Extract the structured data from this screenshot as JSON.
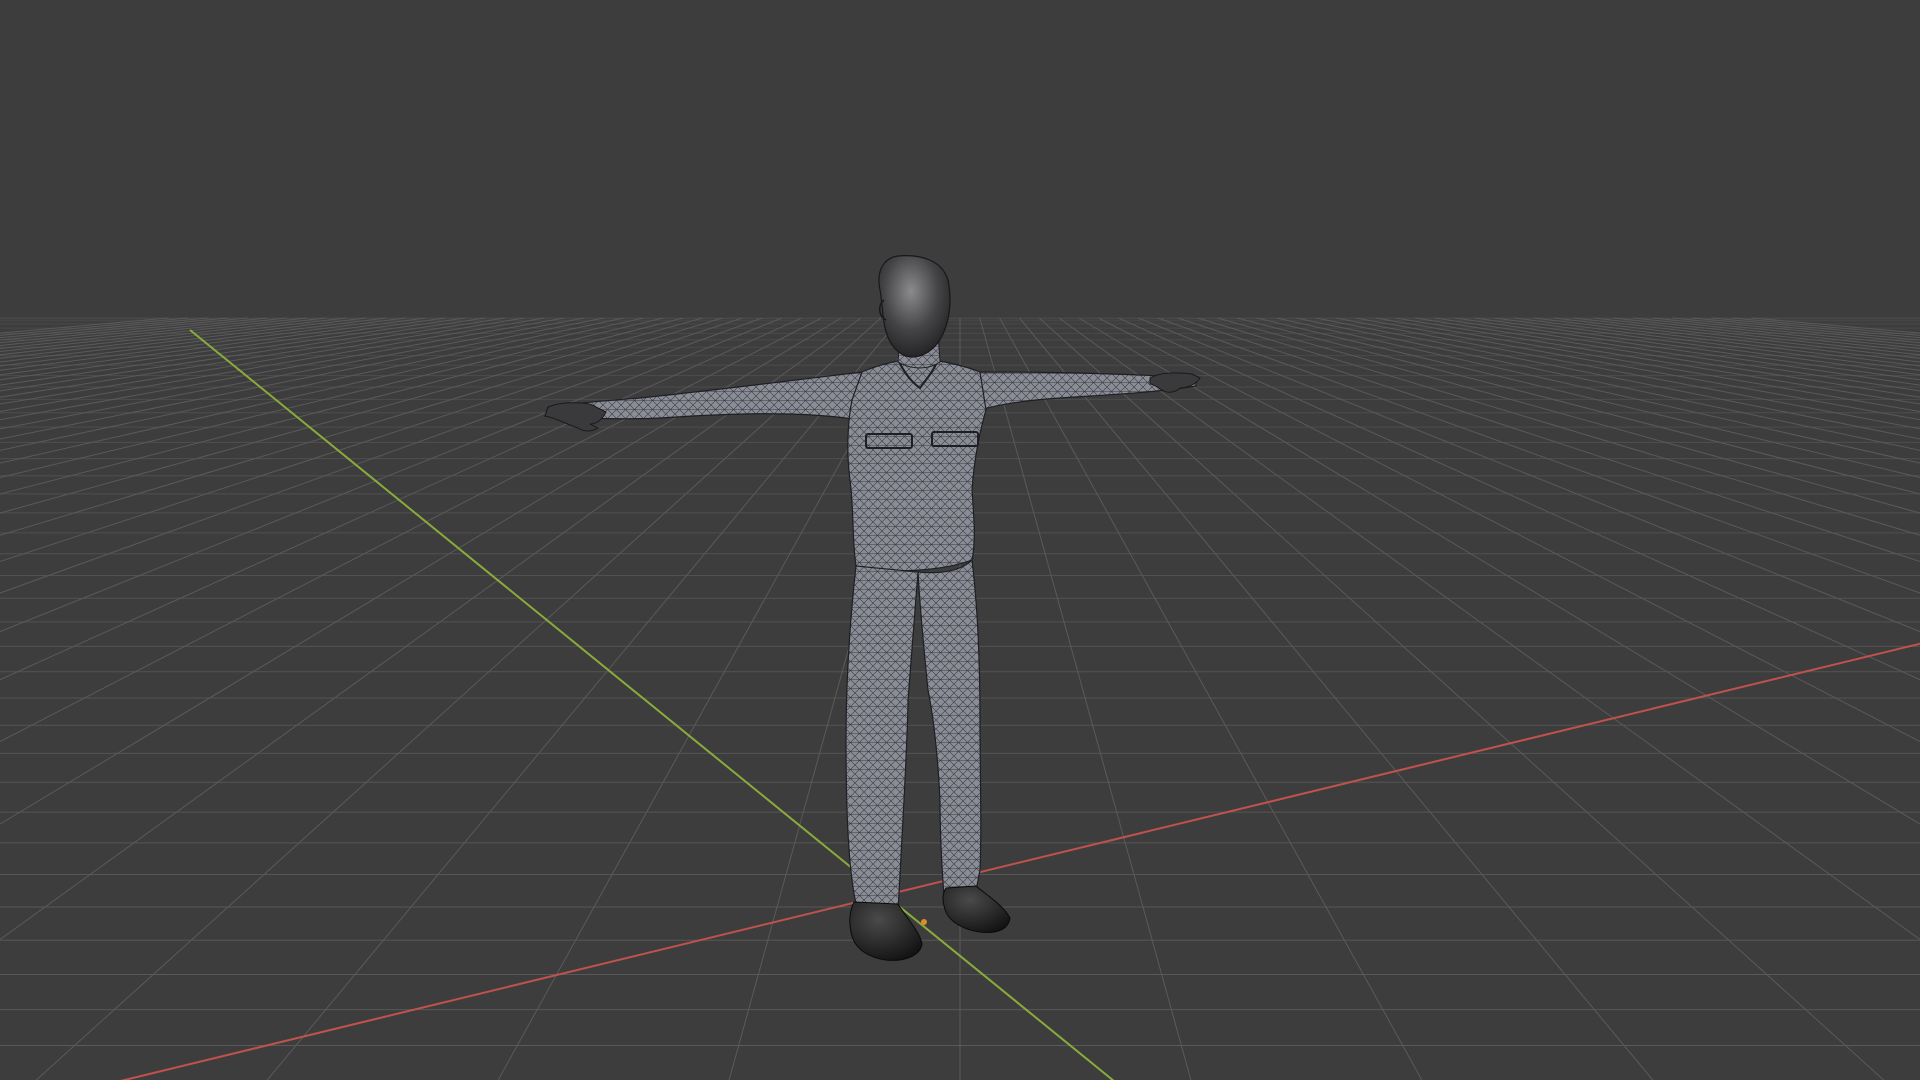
{
  "viewport": {
    "mode": "wireframe-overlay",
    "background_color": "#3d3d3d",
    "grid_color": "#5a5a5a",
    "x_axis_color": "#c0524e",
    "y_axis_color": "#8aab3c",
    "origin_marker_color": "#e08a2a"
  },
  "model": {
    "pose": "T-pose",
    "body_color": "#8a8c96",
    "wire_color": "#1e1f24",
    "skin_color": "#3a3a3c",
    "shoe_color": "#1c1c1c"
  }
}
